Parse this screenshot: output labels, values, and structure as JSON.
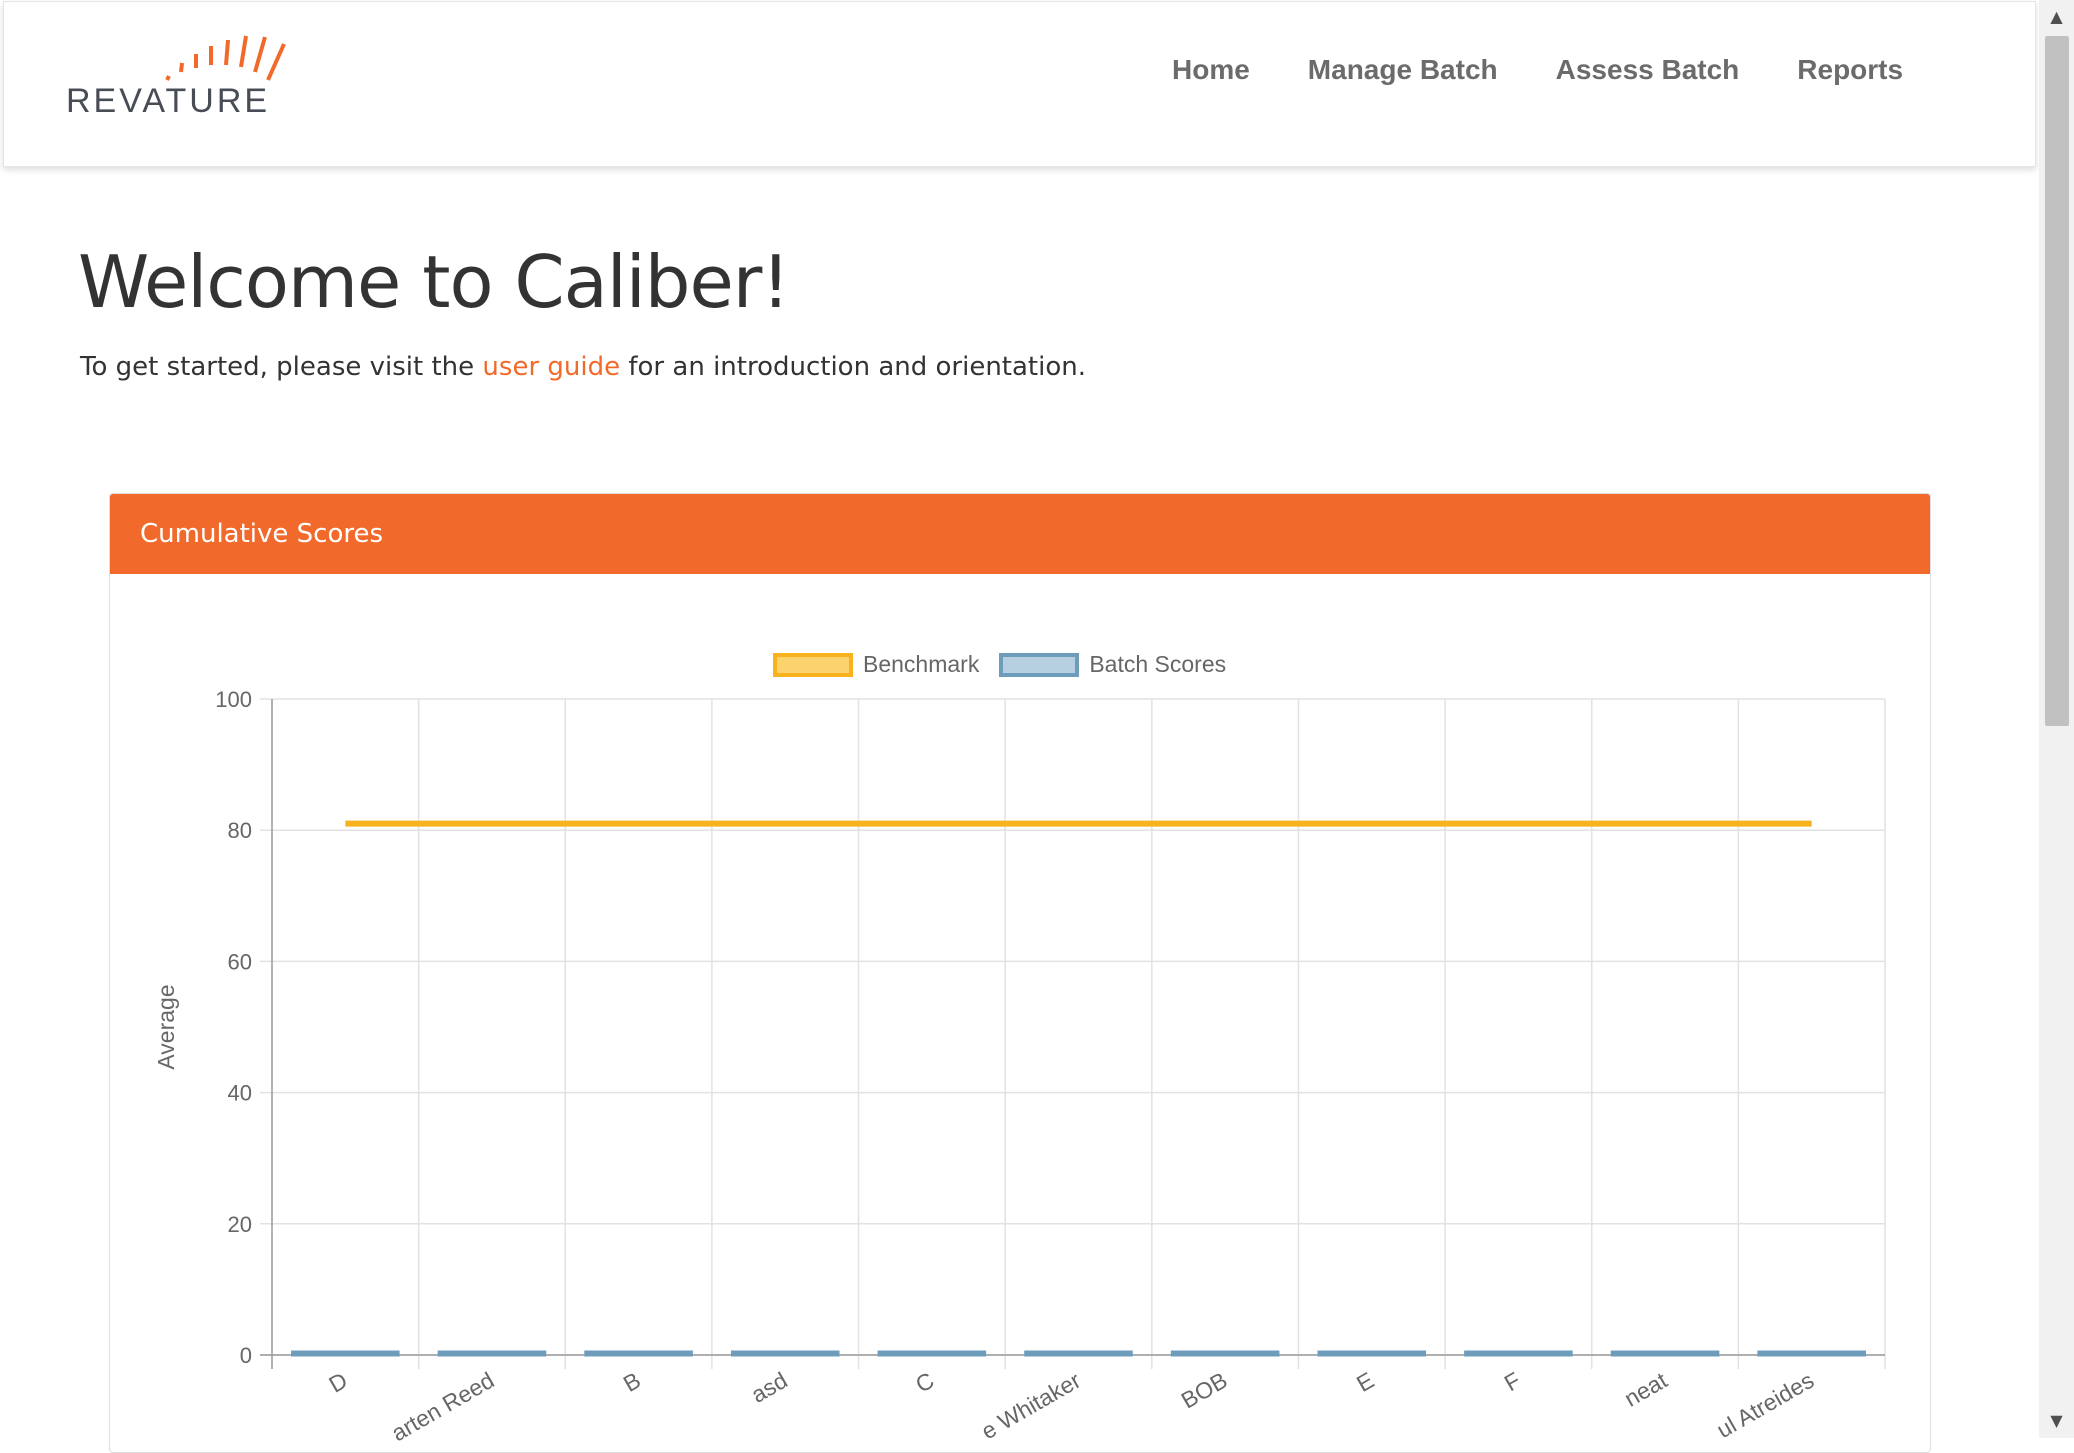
{
  "brand": {
    "logo_text": "REVATURE",
    "accent_color": "#f26a2b"
  },
  "nav": {
    "items": [
      {
        "label": "Home"
      },
      {
        "label": "Manage Batch"
      },
      {
        "label": "Assess Batch"
      },
      {
        "label": "Reports"
      }
    ]
  },
  "main": {
    "title": "Welcome to Caliber!",
    "intro_before": "To get started, please visit the ",
    "intro_link": "user guide",
    "intro_after": " for an introduction and orientation."
  },
  "panel": {
    "title": "Cumulative Scores"
  },
  "chart_data": {
    "type": "bar",
    "ylabel": "Average",
    "ylim": [
      0,
      100
    ],
    "yticks": [
      0,
      20,
      40,
      60,
      80,
      100
    ],
    "grid": true,
    "legend_position": "top",
    "categories": [
      "D",
      "arten Reed",
      "B",
      "asd",
      "C",
      "e Whitaker",
      "BOB",
      "E",
      "F",
      "neat",
      "ul Atreides"
    ],
    "series": [
      {
        "name": "Benchmark",
        "type": "line",
        "color": "#f7b21e",
        "values": [
          81,
          81,
          81,
          81,
          81,
          81,
          81,
          81,
          81,
          81,
          81
        ]
      },
      {
        "name": "Batch Scores",
        "type": "bar",
        "color": "#6e9dbb",
        "values": [
          0,
          0,
          0,
          0,
          0,
          0,
          0,
          0,
          0,
          0,
          0
        ]
      }
    ]
  }
}
